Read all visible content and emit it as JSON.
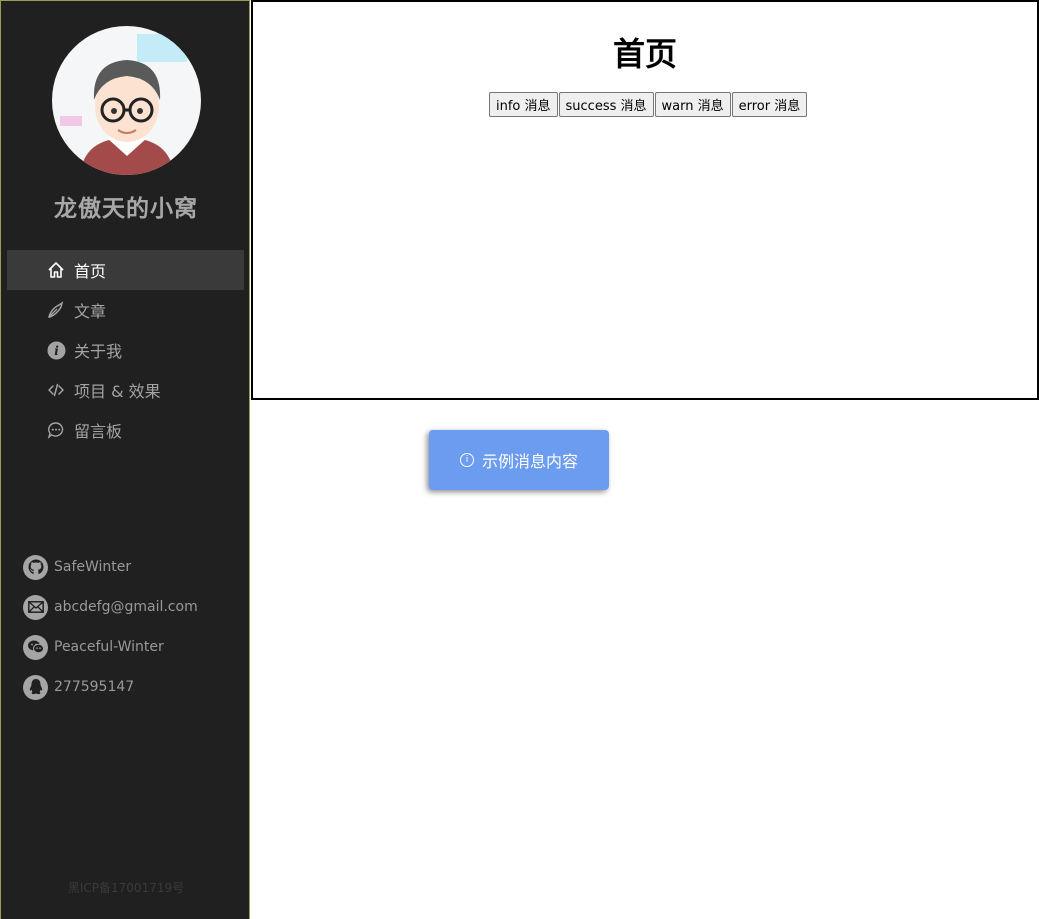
{
  "sidebar": {
    "site_title": "龙傲天的小窝",
    "menu": [
      {
        "label": "首页",
        "icon": "home-icon",
        "active": true
      },
      {
        "label": "文章",
        "icon": "blog-icon"
      },
      {
        "label": "关于我",
        "icon": "info-icon"
      },
      {
        "label": "项目 & 效果",
        "icon": "code-icon"
      },
      {
        "label": "留言板",
        "icon": "chat-icon"
      }
    ],
    "contacts": [
      {
        "label": "SafeWinter",
        "icon": "github-icon"
      },
      {
        "label": "abcdefg@gmail.com",
        "icon": "mail-icon"
      },
      {
        "label": "Peaceful-Winter",
        "icon": "wechat-icon"
      },
      {
        "label": "277595147",
        "icon": "qq-icon"
      }
    ],
    "footer": "黑ICP备17001719号"
  },
  "main": {
    "title": "首页",
    "buttons": [
      "info 消息",
      "success 消息",
      "warn 消息",
      "error 消息"
    ]
  },
  "toast": {
    "icon": "info-circle-icon",
    "text": "示例消息内容",
    "color": "#6b9cf0"
  },
  "colors": {
    "sidebar_bg": "#202020",
    "active_item_bg": "#3a3a3a"
  }
}
